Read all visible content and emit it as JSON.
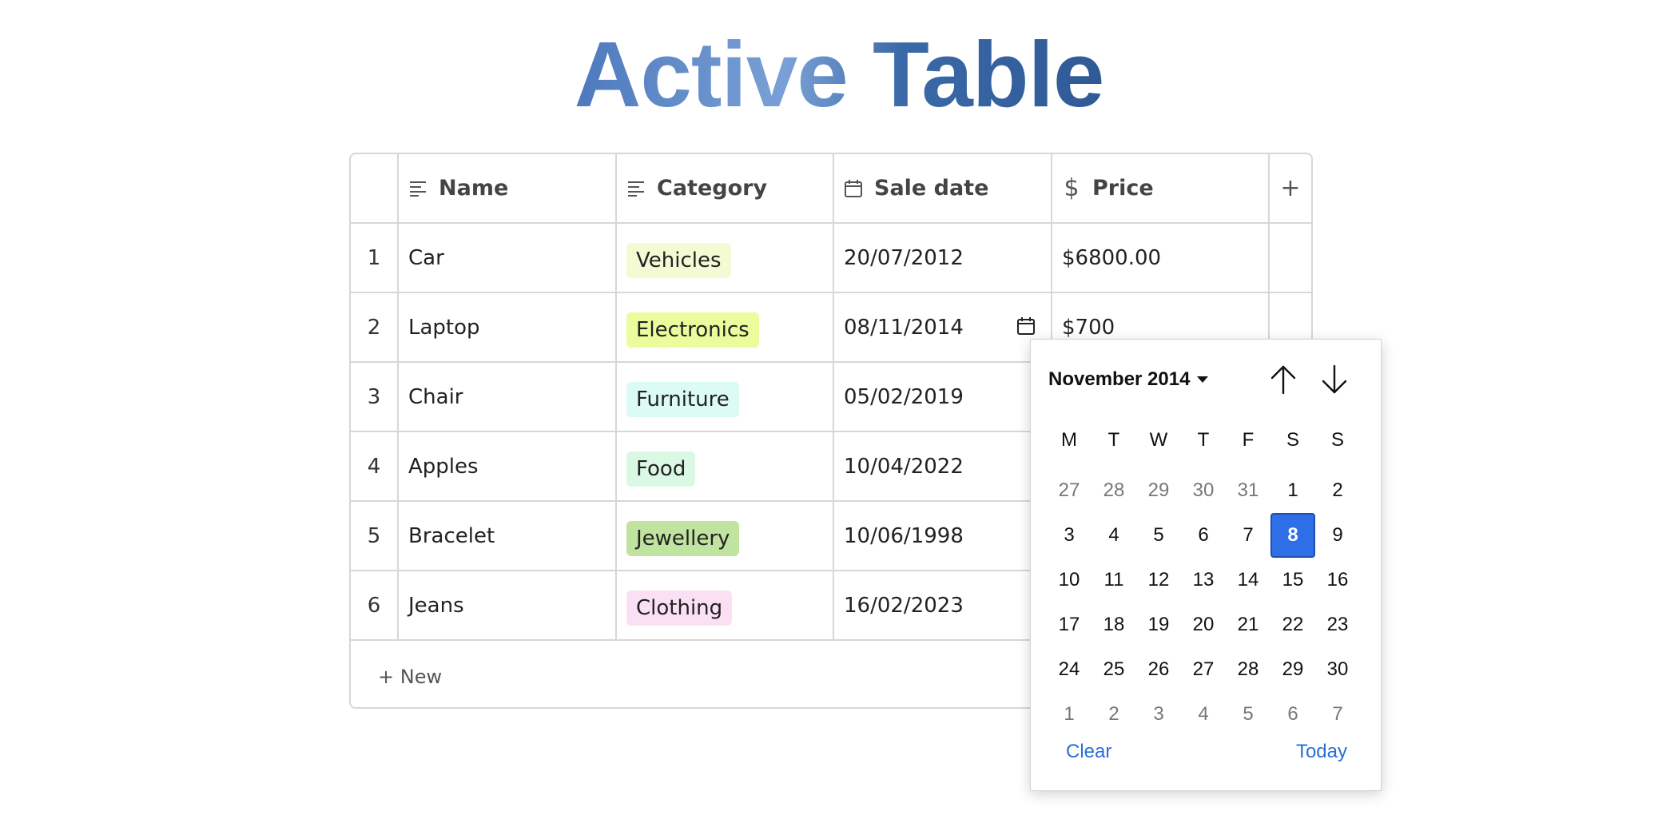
{
  "title": "Active Table",
  "table": {
    "columns": [
      {
        "label": "Name",
        "icon": "text-lines-icon"
      },
      {
        "label": "Category",
        "icon": "text-lines-icon"
      },
      {
        "label": "Sale date",
        "icon": "calendar-icon"
      },
      {
        "label": "Price",
        "icon": "dollar-icon"
      }
    ],
    "add_column": "+",
    "rows": [
      {
        "index": "1",
        "name": "Car",
        "category": "Vehicles",
        "category_color": "#f4fbd4",
        "date": "20/07/2012",
        "price": "$6800.00"
      },
      {
        "index": "2",
        "name": "Laptop",
        "category": "Electronics",
        "category_color": "#eafc9c",
        "date": "08/11/2014",
        "price": "$700"
      },
      {
        "index": "3",
        "name": "Chair",
        "category": "Furniture",
        "category_color": "#dcfbf4",
        "date": "05/02/2019",
        "price": ""
      },
      {
        "index": "4",
        "name": "Apples",
        "category": "Food",
        "category_color": "#daf8e4",
        "date": "10/04/2022",
        "price": ""
      },
      {
        "index": "5",
        "name": "Bracelet",
        "category": "Jewellery",
        "category_color": "#c1e3a0",
        "date": "10/06/1998",
        "price": ""
      },
      {
        "index": "6",
        "name": "Jeans",
        "category": "Clothing",
        "category_color": "#fbe0f3",
        "date": "16/02/2023",
        "price": ""
      }
    ],
    "new_row_label": "+ New"
  },
  "date_picker": {
    "month_label": "November 2014",
    "weekdays": [
      "M",
      "T",
      "W",
      "T",
      "F",
      "S",
      "S"
    ],
    "weeks": [
      [
        {
          "d": "27",
          "m": true
        },
        {
          "d": "28",
          "m": true
        },
        {
          "d": "29",
          "m": true
        },
        {
          "d": "30",
          "m": true
        },
        {
          "d": "31",
          "m": true
        },
        {
          "d": "1"
        },
        {
          "d": "2"
        }
      ],
      [
        {
          "d": "3"
        },
        {
          "d": "4"
        },
        {
          "d": "5"
        },
        {
          "d": "6"
        },
        {
          "d": "7"
        },
        {
          "d": "8",
          "sel": true
        },
        {
          "d": "9"
        }
      ],
      [
        {
          "d": "10"
        },
        {
          "d": "11"
        },
        {
          "d": "12"
        },
        {
          "d": "13"
        },
        {
          "d": "14"
        },
        {
          "d": "15"
        },
        {
          "d": "16"
        }
      ],
      [
        {
          "d": "17"
        },
        {
          "d": "18"
        },
        {
          "d": "19"
        },
        {
          "d": "20"
        },
        {
          "d": "21"
        },
        {
          "d": "22"
        },
        {
          "d": "23"
        }
      ],
      [
        {
          "d": "24"
        },
        {
          "d": "25"
        },
        {
          "d": "26"
        },
        {
          "d": "27"
        },
        {
          "d": "28"
        },
        {
          "d": "29"
        },
        {
          "d": "30"
        }
      ],
      [
        {
          "d": "1",
          "m": true
        },
        {
          "d": "2",
          "m": true
        },
        {
          "d": "3",
          "m": true
        },
        {
          "d": "4",
          "m": true
        },
        {
          "d": "5",
          "m": true
        },
        {
          "d": "6",
          "m": true
        },
        {
          "d": "7",
          "m": true
        }
      ]
    ],
    "clear_label": "Clear",
    "today_label": "Today",
    "accent_color": "#2e6ee6"
  }
}
